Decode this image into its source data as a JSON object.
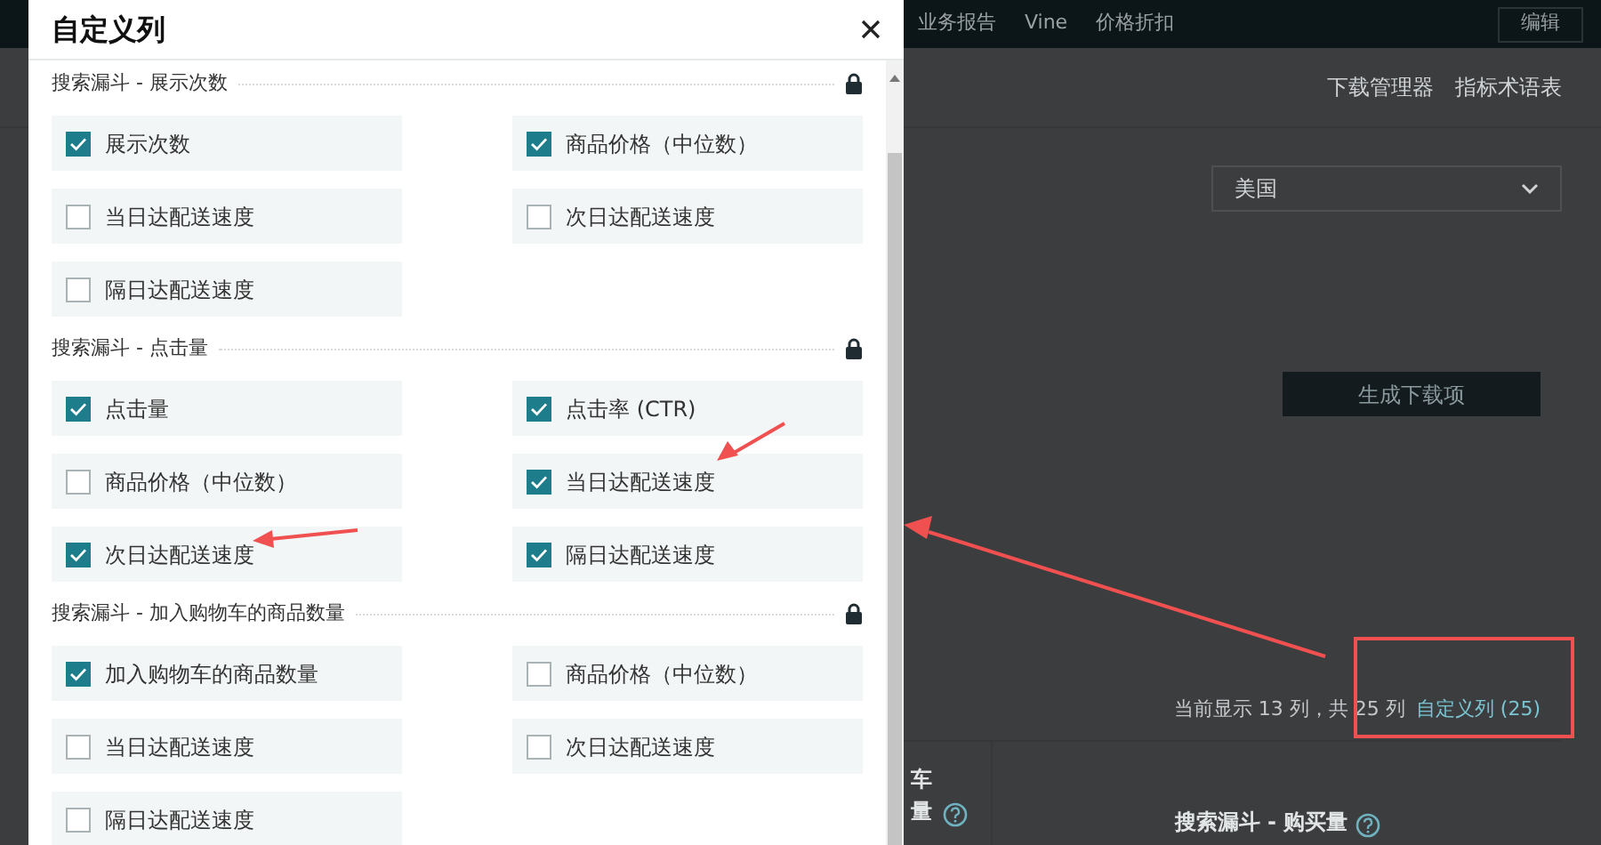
{
  "background": {
    "nav": [
      "业务报告",
      "Vine",
      "价格折扣"
    ],
    "edit_button": "编辑",
    "links": [
      "下载管理器",
      "指标术语表"
    ],
    "country_select": {
      "value": "美国"
    },
    "generate_button": "生成下载项",
    "column_summary": "当前显示 13 列，共 25 列",
    "customize_link": "自定义列 (25)",
    "table_headers": [
      {
        "lines": [
          "车",
          "量"
        ],
        "help": true
      },
      {
        "lines": [
          "搜索漏斗 - 购买量"
        ],
        "help": true
      }
    ]
  },
  "dialog": {
    "title": "自定义列",
    "sections": [
      {
        "title": "搜索漏斗 - 展示次数",
        "locked": true,
        "options": [
          {
            "label": "展示次数",
            "checked": true
          },
          {
            "label": "商品价格（中位数）",
            "checked": true
          },
          {
            "label": "当日达配送速度",
            "checked": false
          },
          {
            "label": "次日达配送速度",
            "checked": false
          },
          {
            "label": "隔日达配送速度",
            "checked": false
          }
        ]
      },
      {
        "title": "搜索漏斗 - 点击量",
        "locked": true,
        "options": [
          {
            "label": "点击量",
            "checked": true
          },
          {
            "label": "点击率 (CTR)",
            "checked": true
          },
          {
            "label": "商品价格（中位数）",
            "checked": false
          },
          {
            "label": "当日达配送速度",
            "checked": true
          },
          {
            "label": "次日达配送速度",
            "checked": true
          },
          {
            "label": "隔日达配送速度",
            "checked": true
          }
        ]
      },
      {
        "title": "搜索漏斗 - 加入购物车的商品数量",
        "locked": true,
        "options": [
          {
            "label": "加入购物车的商品数量",
            "checked": true
          },
          {
            "label": "商品价格（中位数）",
            "checked": false
          },
          {
            "label": "当日达配送速度",
            "checked": false
          },
          {
            "label": "次日达配送速度",
            "checked": false
          },
          {
            "label": "隔日达配送速度",
            "checked": false
          }
        ]
      }
    ]
  }
}
